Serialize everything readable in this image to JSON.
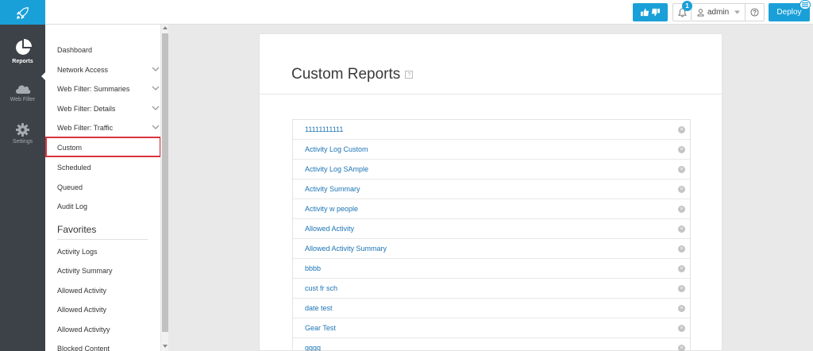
{
  "header": {
    "admin_label": "admin",
    "badge_count": "1",
    "deploy_label": "Deploy",
    "accent_color": "#1aa0d8",
    "icons": [
      "rocket-icon",
      "thumbs-icon",
      "bell-icon",
      "user-icon",
      "help-icon",
      "list-icon"
    ]
  },
  "rail": {
    "items": [
      {
        "label": "Reports",
        "icon": "pie-chart-icon",
        "active": true
      },
      {
        "label": "Web Filter",
        "icon": "cloud-icon",
        "active": false
      },
      {
        "label": "Settings",
        "icon": "gear-icon",
        "active": false
      }
    ]
  },
  "subnav": {
    "items": [
      {
        "label": "Dashboard",
        "expandable": false
      },
      {
        "label": "Network Access",
        "expandable": true
      },
      {
        "label": "Web Filter: Summaries",
        "expandable": true
      },
      {
        "label": "Web Filter: Details",
        "expandable": true
      },
      {
        "label": "Web Filter: Traffic",
        "expandable": true
      },
      {
        "label": "Custom",
        "expandable": false,
        "selected": true
      },
      {
        "label": "Scheduled",
        "expandable": false
      },
      {
        "label": "Queued",
        "expandable": false
      },
      {
        "label": "Audit Log",
        "expandable": false
      }
    ],
    "favorites_title": "Favorites",
    "favorites": [
      "Activity Logs",
      "Activity Summary",
      "Allowed Activity",
      "Allowed Activity",
      "Allowed Activityy",
      "Blocked Content"
    ]
  },
  "main": {
    "title": "Custom Reports",
    "reports": [
      "11111111111",
      "Activity Log Custom",
      "Activity Log SAmple",
      "Activity Summary",
      "Activity w people",
      "Allowed Activity",
      "Allowed Activity Summary",
      "bbbb",
      "cust fr sch",
      "date test",
      "Gear Test",
      "gggg"
    ]
  }
}
